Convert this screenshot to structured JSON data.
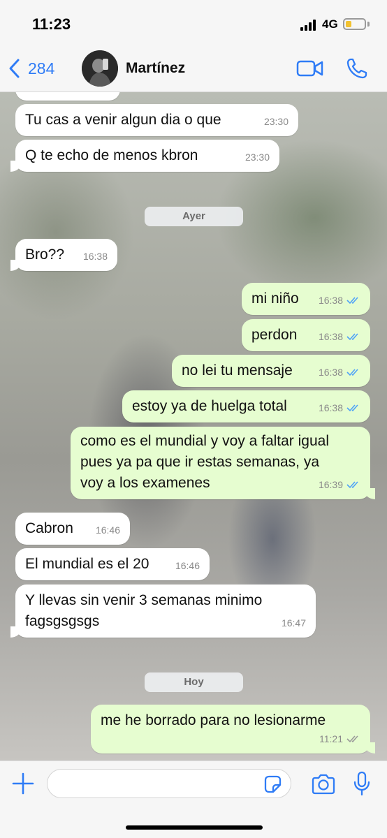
{
  "status_bar": {
    "time": "11:23",
    "network": "4G",
    "battery_level": 0.3,
    "battery_color": "#f2c230"
  },
  "header": {
    "back_count": "284",
    "contact_name": "Martínez",
    "accent_color": "#2f7cf6"
  },
  "chat": {
    "partial_time": "23:30",
    "messages": [
      {
        "dir": "in",
        "text": "Tu cas a venir algun dia o que",
        "time": "23:30"
      },
      {
        "dir": "in",
        "text": "Q te echo de menos kbron",
        "time": "23:30"
      },
      {
        "dir": "in",
        "text": "Bro??",
        "time": "16:38"
      },
      {
        "dir": "out",
        "text": "mi niño",
        "time": "16:38",
        "read": true
      },
      {
        "dir": "out",
        "text": "perdon",
        "time": "16:38",
        "read": true
      },
      {
        "dir": "out",
        "text": "no lei tu mensaje",
        "time": "16:38",
        "read": true
      },
      {
        "dir": "out",
        "text": "estoy ya de huelga total",
        "time": "16:38",
        "read": true
      },
      {
        "dir": "out",
        "text": "como es el mundial y voy a faltar igual\npues ya pa que ir estas semanas, ya\nvoy a los examenes",
        "time": "16:39",
        "read": true
      },
      {
        "dir": "in",
        "text": "Cabron",
        "time": "16:46"
      },
      {
        "dir": "in",
        "text": "El mundial es el 20",
        "time": "16:46"
      },
      {
        "dir": "in",
        "text": "Y llevas sin venir 3 semanas minimo\nfagsgsgsgs",
        "time": "16:47"
      },
      {
        "dir": "out",
        "text": "me he borrado para no lesionarme",
        "time": "11:21",
        "read": false
      }
    ],
    "date_chips": [
      "Ayer",
      "Hoy"
    ],
    "incoming_color": "#ffffff",
    "outgoing_color": "#e6fdd0",
    "read_check_color": "#4fa3f7",
    "unread_check_color": "#9a9a9a"
  },
  "input": {
    "placeholder": ""
  },
  "icons": {
    "back": "chevron-left-icon",
    "video": "video-camera-icon",
    "phone": "phone-icon",
    "plus": "plus-icon",
    "sticker": "sticker-icon",
    "camera": "camera-icon",
    "mic": "microphone-icon"
  }
}
